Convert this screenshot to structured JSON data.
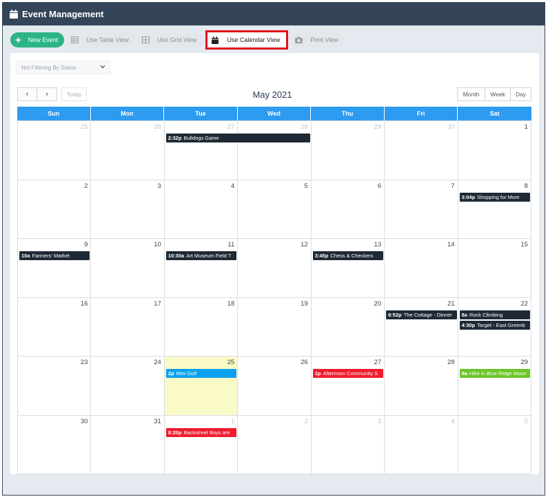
{
  "app": {
    "title": "Event Management"
  },
  "toolbar": {
    "new_event": "New Event",
    "table_view": "Use Table View",
    "grid_view": "Use Grid View",
    "calendar_view": "Use Calendar View",
    "print_view": "Print View"
  },
  "filter": {
    "selected": "Not Filtering By Status"
  },
  "calendar": {
    "title": "May 2021",
    "today_label": "Today",
    "prev_icon": "‹",
    "next_icon": "›",
    "views": [
      "Month",
      "Week",
      "Day"
    ],
    "weekdays": [
      "Sun",
      "Mon",
      "Tue",
      "Wed",
      "Thu",
      "Fri",
      "Sat"
    ],
    "weeks": [
      [
        {
          "d": "25",
          "m": true
        },
        {
          "d": "26",
          "m": true
        },
        {
          "d": "27",
          "m": true
        },
        {
          "d": "28",
          "m": true
        },
        {
          "d": "29",
          "m": true
        },
        {
          "d": "30",
          "m": true
        },
        {
          "d": "1",
          "m": false
        }
      ],
      [
        {
          "d": "2",
          "m": false
        },
        {
          "d": "3",
          "m": false
        },
        {
          "d": "4",
          "m": false
        },
        {
          "d": "5",
          "m": false
        },
        {
          "d": "6",
          "m": false
        },
        {
          "d": "7",
          "m": false
        },
        {
          "d": "8",
          "m": false
        }
      ],
      [
        {
          "d": "9",
          "m": false
        },
        {
          "d": "10",
          "m": false
        },
        {
          "d": "11",
          "m": false
        },
        {
          "d": "12",
          "m": false
        },
        {
          "d": "13",
          "m": false
        },
        {
          "d": "14",
          "m": false
        },
        {
          "d": "15",
          "m": false
        }
      ],
      [
        {
          "d": "16",
          "m": false
        },
        {
          "d": "17",
          "m": false
        },
        {
          "d": "18",
          "m": false
        },
        {
          "d": "19",
          "m": false
        },
        {
          "d": "20",
          "m": false
        },
        {
          "d": "21",
          "m": false
        },
        {
          "d": "22",
          "m": false
        }
      ],
      [
        {
          "d": "23",
          "m": false
        },
        {
          "d": "24",
          "m": false
        },
        {
          "d": "25",
          "m": false,
          "today": true
        },
        {
          "d": "26",
          "m": false
        },
        {
          "d": "27",
          "m": false
        },
        {
          "d": "28",
          "m": false
        },
        {
          "d": "29",
          "m": false
        }
      ],
      [
        {
          "d": "30",
          "m": false
        },
        {
          "d": "31",
          "m": false
        },
        {
          "d": "1",
          "m": true
        },
        {
          "d": "2",
          "m": true
        },
        {
          "d": "3",
          "m": true
        },
        {
          "d": "4",
          "m": true
        },
        {
          "d": "5",
          "m": true
        }
      ]
    ],
    "events": [
      {
        "week": 0,
        "start": 2,
        "span": 2,
        "slot": 0,
        "time": "2:32p",
        "title": "Bulldogs Game",
        "color": "#1f2a36"
      },
      {
        "week": 1,
        "start": 6,
        "span": 1,
        "slot": 0,
        "time": "3:04p",
        "title": "Shopping for Mom",
        "color": "#1f2a36"
      },
      {
        "week": 2,
        "start": 0,
        "span": 1,
        "slot": 0,
        "time": "10a",
        "title": "Farmers' Market",
        "color": "#1f2a36"
      },
      {
        "week": 2,
        "start": 2,
        "span": 1,
        "slot": 0,
        "time": "10:30a",
        "title": "Art Museum Field T",
        "color": "#1f2a36"
      },
      {
        "week": 2,
        "start": 4,
        "span": 1,
        "slot": 0,
        "time": "3:45p",
        "title": "Chess & Checkers",
        "color": "#1f2a36"
      },
      {
        "week": 3,
        "start": 5,
        "span": 1,
        "slot": 0,
        "time": "6:52p",
        "title": "The Cottage - Dinner",
        "color": "#1f2a36"
      },
      {
        "week": 3,
        "start": 6,
        "span": 1,
        "slot": 0,
        "time": "8a",
        "title": "Rock Climbing",
        "color": "#1f2a36"
      },
      {
        "week": 3,
        "start": 6,
        "span": 1,
        "slot": 1,
        "time": "4:30p",
        "title": "Target - East Greenb",
        "color": "#1f2a36"
      },
      {
        "week": 4,
        "start": 2,
        "span": 1,
        "slot": 0,
        "time": "2p",
        "title": "Mini Golf",
        "color": "#0aa2ef"
      },
      {
        "week": 4,
        "start": 4,
        "span": 1,
        "slot": 0,
        "time": "1p",
        "title": "Afternoon Community S",
        "color": "#ef1c2e"
      },
      {
        "week": 4,
        "start": 6,
        "span": 1,
        "slot": 0,
        "time": "8a",
        "title": "Hike in Blue Ridge Moun",
        "color": "#6dc429"
      },
      {
        "week": 5,
        "start": 2,
        "span": 1,
        "slot": 0,
        "time": "8:20p",
        "title": "Backstreet Boys are",
        "color": "#ef1c2e"
      }
    ]
  }
}
